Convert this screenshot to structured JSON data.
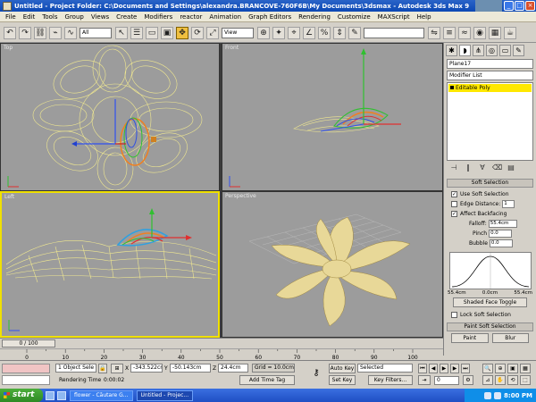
{
  "window": {
    "title": "Untitled   - Project Folder: C:\\Documents and Settings\\alexandra.BRANCOVE-760F6B\\My Documents\\3dsmax   - Autodesk 3ds Max 9",
    "buttons": {
      "minimize": "_",
      "maximize": "□",
      "close": "×"
    }
  },
  "menu": [
    "File",
    "Edit",
    "Tools",
    "Group",
    "Views",
    "Create",
    "Modifiers",
    "reactor",
    "Animation",
    "Graph Editors",
    "Rendering",
    "Customize",
    "MAXScript",
    "Help"
  ],
  "toolbar": {
    "selection_filter": "All",
    "coord_system": "View"
  },
  "viewports": {
    "top": "Top",
    "front": "Front",
    "left": "Left",
    "perspective": "Perspective"
  },
  "command_panel": {
    "object_name": "Plane17",
    "modifier_list": "Modifier List",
    "stack_item": "Editable Poly",
    "soft_selection": {
      "title": "Soft Selection",
      "use_soft_selection": "Use Soft Selection",
      "edge_distance": "Edge Distance:",
      "edge_distance_value": "1",
      "affect_backfacing": "Affect Backfacing",
      "falloff_label": "Falloff:",
      "falloff_value": "55.4cm",
      "pinch_label": "Pinch",
      "pinch_value": "0.0",
      "bubble_label": "Bubble",
      "bubble_value": "0.0",
      "curve_left": "55.4cm",
      "curve_mid": "0.0cm",
      "curve_right": "55.4cm",
      "shaded_face_toggle": "Shaded Face Toggle",
      "lock_soft_selection": "Lock Soft Selection",
      "paint_title": "Paint Soft Selection",
      "paint_btn": "Paint",
      "blur_btn": "Blur"
    }
  },
  "timeline": {
    "frame": "0 / 100",
    "ticks": [
      "0",
      "10",
      "20",
      "30",
      "40",
      "50",
      "60",
      "70",
      "80",
      "90",
      "100"
    ]
  },
  "status": {
    "selected_count": "1 Object Sele",
    "x_label": "X",
    "x_value": "-343.522cr",
    "y_label": "Y",
    "y_value": "-50.143cm",
    "z_label": "Z",
    "z_value": "24.4cm",
    "grid": "Grid = 10.0cm",
    "auto_key": "Auto Key",
    "selected_dropdown": "Selected",
    "set_key": "Set Key",
    "key_filters": "Key Filters...",
    "rendering_time_label": "Rendering Time",
    "rendering_time": "0:00:02",
    "add_time_tag": "Add Time Tag",
    "frame_field": "0"
  },
  "taskbar": {
    "start": "start",
    "tasks": [
      "flower - Căutare G...",
      "Untitled   - Projec..."
    ],
    "clock": "8:00 PM"
  },
  "colors": {
    "wire": "#f0e890",
    "viewport_bg": "#9c9c9c",
    "active_border": "#f0e000",
    "flower_shaded": "#e8d898"
  }
}
